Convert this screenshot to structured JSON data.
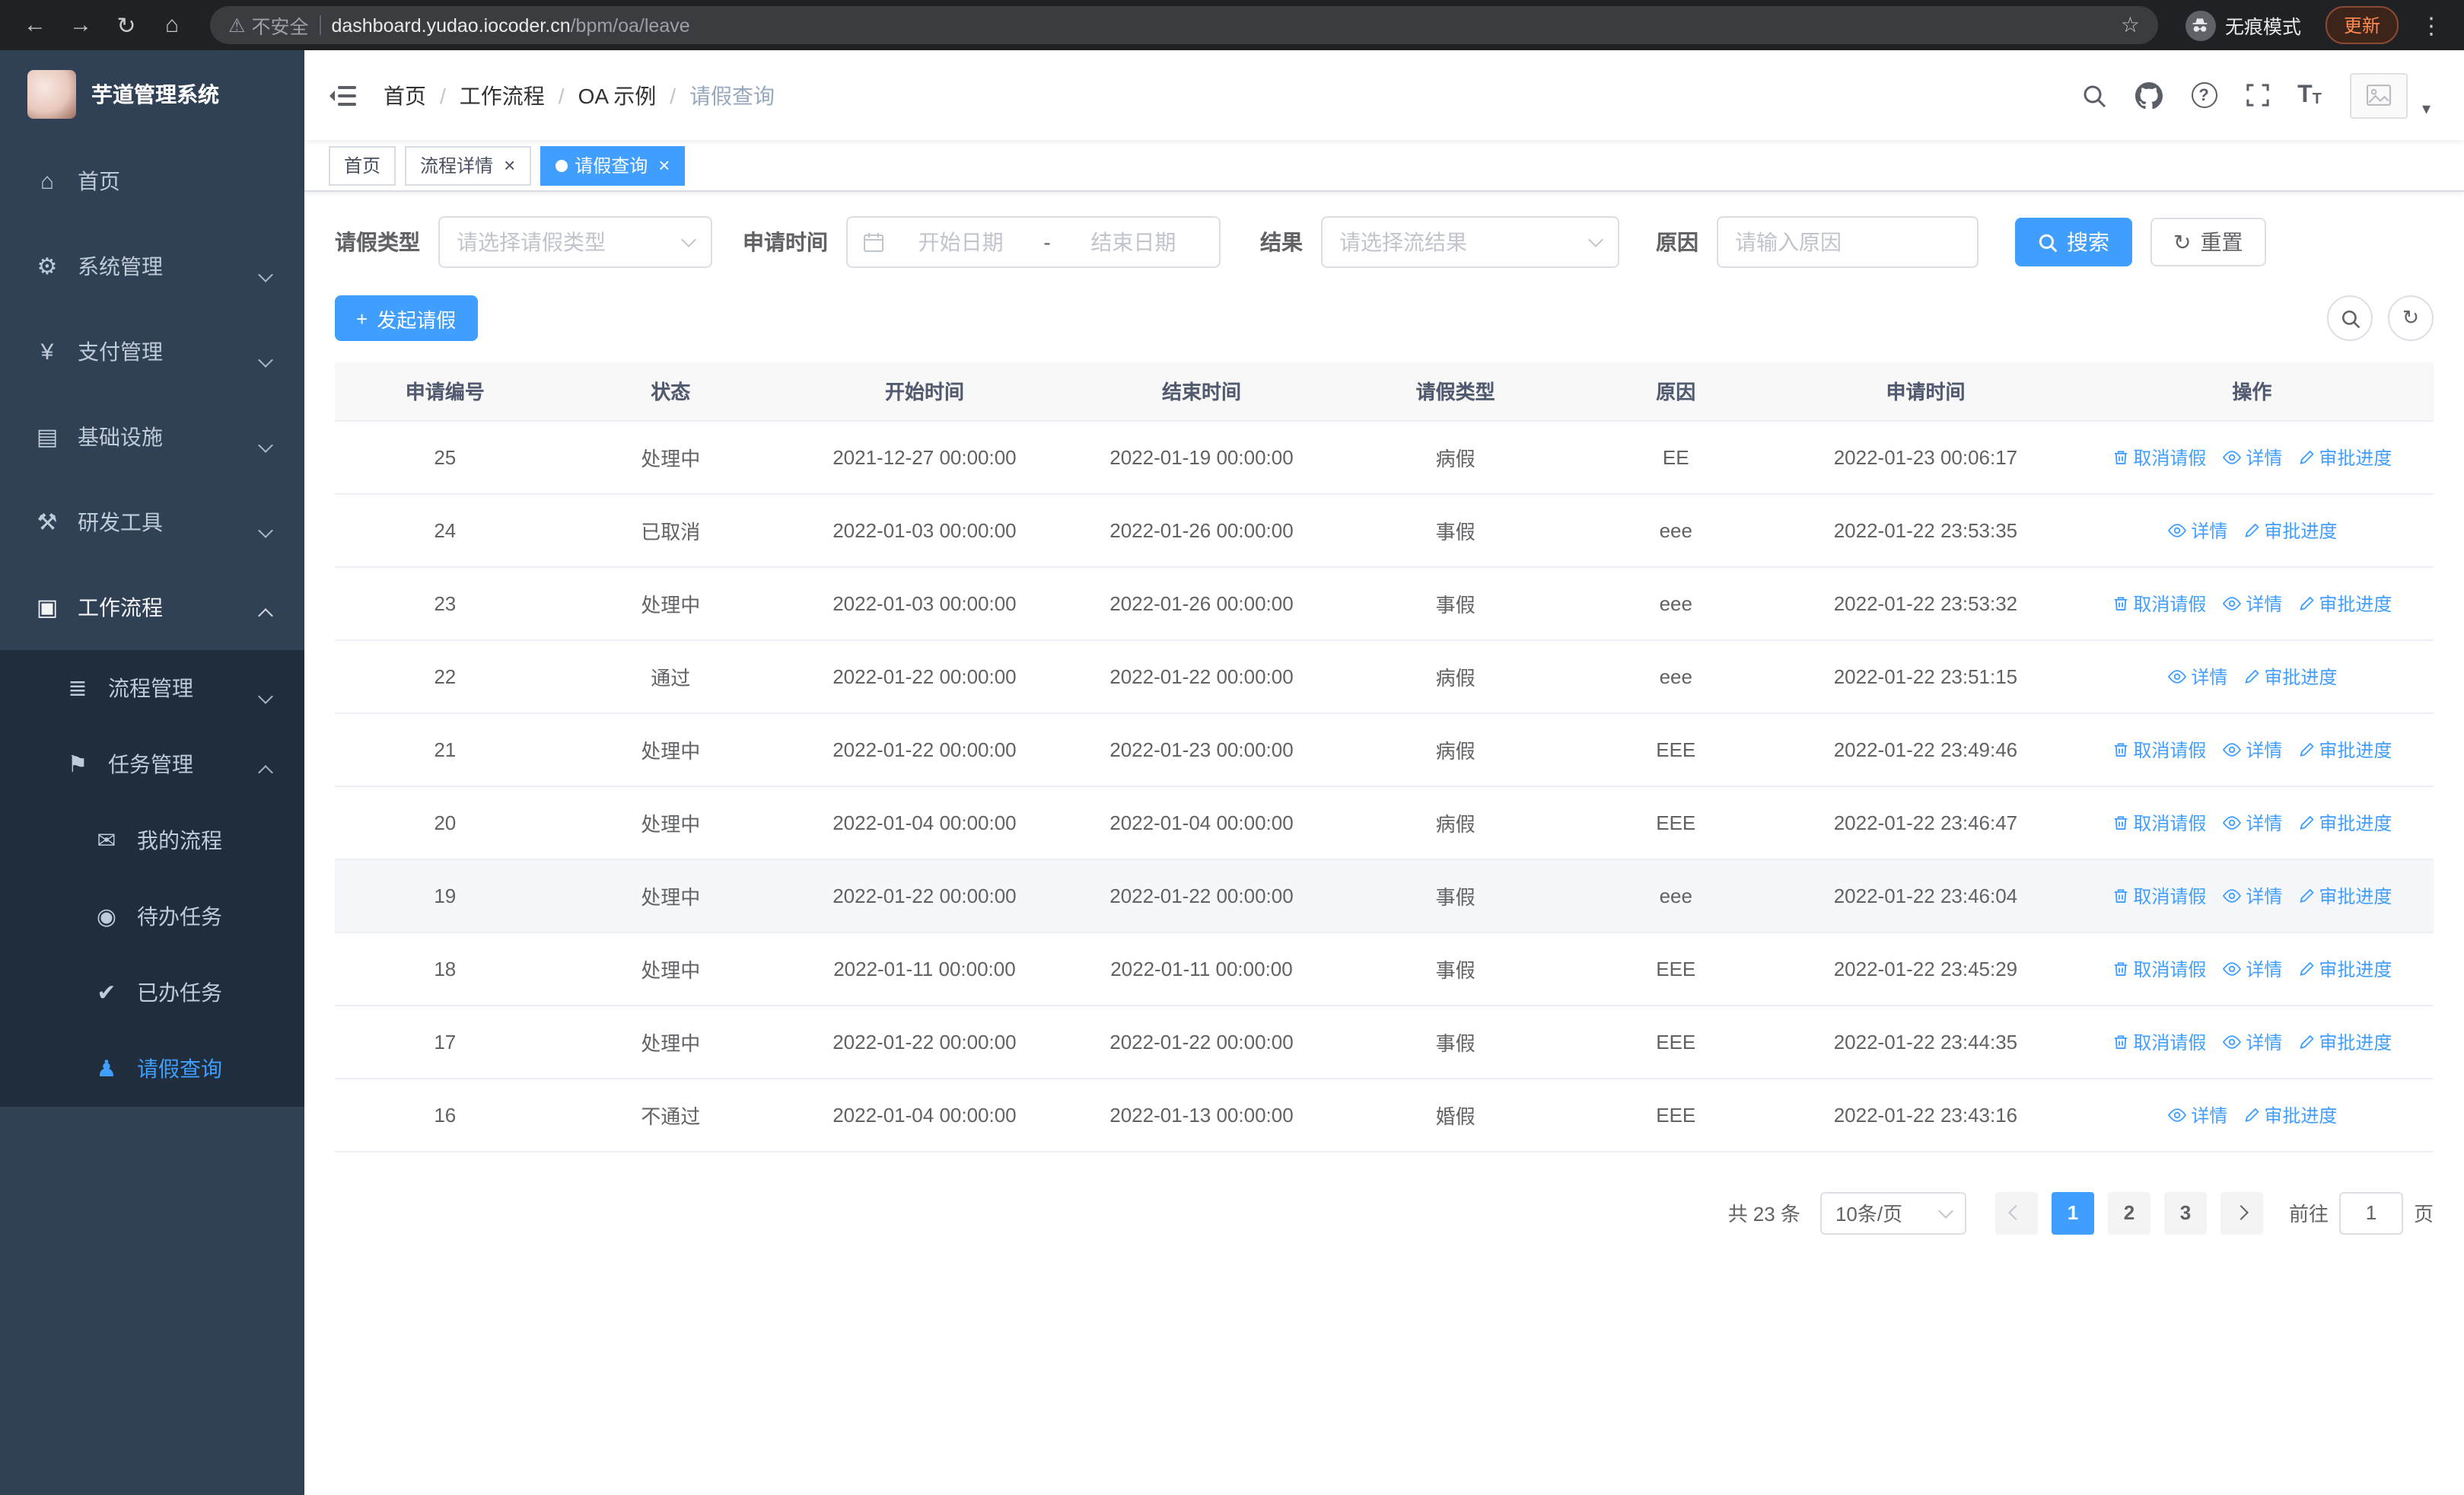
{
  "browser": {
    "security_label": "不安全",
    "url_host": "dashboard.yudao.iocoder.cn",
    "url_path": "/bpm/oa/leave",
    "incognito_label": "无痕模式",
    "update_label": "更新"
  },
  "icons": {
    "back-icon": "←",
    "forward-icon": "→",
    "reload-icon": "↻",
    "home-nav-icon": "⌂",
    "star-icon": "☆",
    "warning-icon": "⚠",
    "more-icon": "⋮",
    "caret-down-icon": "▾",
    "question-icon": "?",
    "font-size-icon": "T",
    "home-icon": "⌂",
    "gear-icon": "⚙",
    "yen-icon": "¥",
    "infrastructure-icon": "▤",
    "devtools-icon": "⚒",
    "workflow-icon": "▣",
    "process-icon": "≣",
    "task-icon": "⚑",
    "my-process-icon": "✉",
    "todo-icon": "◉",
    "done-icon": "✔",
    "user-icon": "♟",
    "refresh-icon": "↻",
    "plus-icon": "+"
  },
  "sidebar": {
    "app_title": "芋道管理系统",
    "items": [
      {
        "id": "home",
        "label": "首页",
        "icon": "home-icon",
        "level": 1
      },
      {
        "id": "system",
        "label": "系统管理",
        "icon": "gear-icon",
        "level": 1,
        "arrow": "down"
      },
      {
        "id": "payment",
        "label": "支付管理",
        "icon": "yen-icon",
        "level": 1,
        "arrow": "down"
      },
      {
        "id": "infrastructure",
        "label": "基础设施",
        "icon": "infrastructure-icon",
        "level": 1,
        "arrow": "down"
      },
      {
        "id": "devtools",
        "label": "研发工具",
        "icon": "devtools-icon",
        "level": 1,
        "arrow": "down"
      },
      {
        "id": "workflow",
        "label": "工作流程",
        "icon": "workflow-icon",
        "level": 1,
        "arrow": "up",
        "bright": true
      },
      {
        "id": "process-mgmt",
        "label": "流程管理",
        "icon": "process-icon",
        "level": 2,
        "arrow": "down"
      },
      {
        "id": "task-mgmt",
        "label": "任务管理",
        "icon": "task-icon",
        "level": 2,
        "arrow": "up"
      },
      {
        "id": "my-process",
        "label": "我的流程",
        "icon": "my-process-icon",
        "level": 3
      },
      {
        "id": "todo-tasks",
        "label": "待办任务",
        "icon": "todo-icon",
        "level": 3
      },
      {
        "id": "done-tasks",
        "label": "已办任务",
        "icon": "done-icon",
        "level": 3
      },
      {
        "id": "leave-query",
        "label": "请假查询",
        "icon": "user-icon",
        "level": 3,
        "active": true
      }
    ]
  },
  "header": {
    "breadcrumbs": [
      "首页",
      "工作流程",
      "OA 示例",
      "请假查询"
    ]
  },
  "tabs": [
    {
      "id": "home",
      "label": "首页",
      "closable": false,
      "active": false
    },
    {
      "id": "process-detail",
      "label": "流程详情",
      "closable": true,
      "active": false
    },
    {
      "id": "leave-query",
      "label": "请假查询",
      "closable": true,
      "active": true
    }
  ],
  "filters": {
    "leave_type_label": "请假类型",
    "leave_type_placeholder": "请选择请假类型",
    "apply_time_label": "申请时间",
    "date_start_placeholder": "开始日期",
    "date_separator": "-",
    "date_end_placeholder": "结束日期",
    "result_label": "结果",
    "result_placeholder": "请选择流结果",
    "reason_label": "原因",
    "reason_placeholder": "请输入原因",
    "search_label": "搜索",
    "reset_label": "重置"
  },
  "toolbar": {
    "create_label": "发起请假"
  },
  "table": {
    "columns": [
      "申请编号",
      "状态",
      "开始时间",
      "结束时间",
      "请假类型",
      "原因",
      "申请时间",
      "操作"
    ],
    "action_labels": {
      "cancel": "取消请假",
      "detail": "详情",
      "progress": "审批进度"
    },
    "rows": [
      {
        "id": "25",
        "status": "处理中",
        "start": "2021-12-27 00:00:00",
        "end": "2022-01-19 00:00:00",
        "type": "病假",
        "reason": "EE",
        "apply_time": "2022-01-23 00:06:17",
        "actions": [
          "cancel",
          "detail",
          "progress"
        ]
      },
      {
        "id": "24",
        "status": "已取消",
        "start": "2022-01-03 00:00:00",
        "end": "2022-01-26 00:00:00",
        "type": "事假",
        "reason": "eee",
        "apply_time": "2022-01-22 23:53:35",
        "actions": [
          "detail",
          "progress"
        ]
      },
      {
        "id": "23",
        "status": "处理中",
        "start": "2022-01-03 00:00:00",
        "end": "2022-01-26 00:00:00",
        "type": "事假",
        "reason": "eee",
        "apply_time": "2022-01-22 23:53:32",
        "actions": [
          "cancel",
          "detail",
          "progress"
        ]
      },
      {
        "id": "22",
        "status": "通过",
        "start": "2022-01-22 00:00:00",
        "end": "2022-01-22 00:00:00",
        "type": "病假",
        "reason": "eee",
        "apply_time": "2022-01-22 23:51:15",
        "actions": [
          "detail",
          "progress"
        ]
      },
      {
        "id": "21",
        "status": "处理中",
        "start": "2022-01-22 00:00:00",
        "end": "2022-01-23 00:00:00",
        "type": "病假",
        "reason": "EEE",
        "apply_time": "2022-01-22 23:49:46",
        "actions": [
          "cancel",
          "detail",
          "progress"
        ]
      },
      {
        "id": "20",
        "status": "处理中",
        "start": "2022-01-04 00:00:00",
        "end": "2022-01-04 00:00:00",
        "type": "病假",
        "reason": "EEE",
        "apply_time": "2022-01-22 23:46:47",
        "actions": [
          "cancel",
          "detail",
          "progress"
        ]
      },
      {
        "id": "19",
        "status": "处理中",
        "start": "2022-01-22 00:00:00",
        "end": "2022-01-22 00:00:00",
        "type": "事假",
        "reason": "eee",
        "apply_time": "2022-01-22 23:46:04",
        "actions": [
          "cancel",
          "detail",
          "progress"
        ],
        "highlighted": true
      },
      {
        "id": "18",
        "status": "处理中",
        "start": "2022-01-11 00:00:00",
        "end": "2022-01-11 00:00:00",
        "type": "事假",
        "reason": "EEE",
        "apply_time": "2022-01-22 23:45:29",
        "actions": [
          "cancel",
          "detail",
          "progress"
        ]
      },
      {
        "id": "17",
        "status": "处理中",
        "start": "2022-01-22 00:00:00",
        "end": "2022-01-22 00:00:00",
        "type": "事假",
        "reason": "EEE",
        "apply_time": "2022-01-22 23:44:35",
        "actions": [
          "cancel",
          "detail",
          "progress"
        ]
      },
      {
        "id": "16",
        "status": "不通过",
        "start": "2022-01-04 00:00:00",
        "end": "2022-01-13 00:00:00",
        "type": "婚假",
        "reason": "EEE",
        "apply_time": "2022-01-22 23:43:16",
        "actions": [
          "detail",
          "progress"
        ]
      }
    ]
  },
  "pagination": {
    "total_text": "共 23 条",
    "page_size": "10条/页",
    "pages": [
      "1",
      "2",
      "3"
    ],
    "active_page": "1",
    "goto_label": "前往",
    "goto_value": "1",
    "page_suffix": "页"
  }
}
